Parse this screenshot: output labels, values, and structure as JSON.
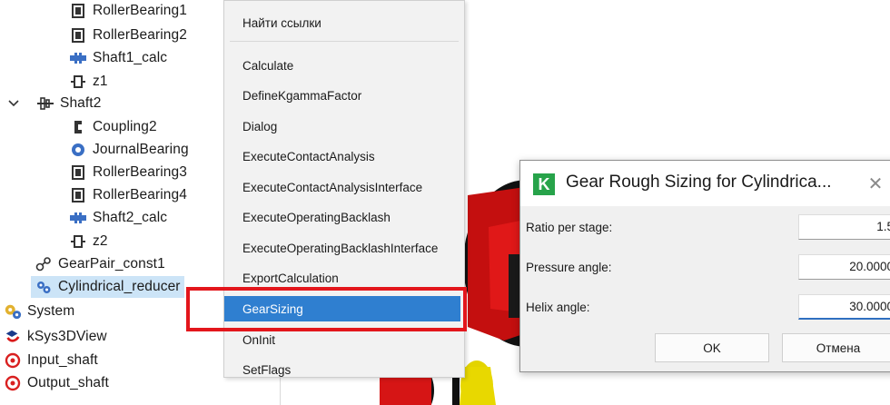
{
  "tree": {
    "items": [
      {
        "label": "RollerBearing1",
        "icon": "bearing-icon"
      },
      {
        "label": "RollerBearing2",
        "icon": "bearing-icon"
      },
      {
        "label": "Shaft1_calc",
        "icon": "shaft-calc-icon"
      },
      {
        "label": "z1",
        "icon": "gear-node-icon"
      },
      {
        "label": "Shaft2",
        "icon": "shaft-icon"
      },
      {
        "label": "Coupling2",
        "icon": "coupling-icon"
      },
      {
        "label": "JournalBearing",
        "icon": "journal-bearing-icon"
      },
      {
        "label": "RollerBearing3",
        "icon": "bearing-icon"
      },
      {
        "label": "RollerBearing4",
        "icon": "bearing-icon"
      },
      {
        "label": "Shaft2_calc",
        "icon": "shaft-calc-icon"
      },
      {
        "label": "z2",
        "icon": "gear-node-icon"
      },
      {
        "label": "GearPair_const1",
        "icon": "gear-pair-icon"
      },
      {
        "label": "Cylindrical_reducer",
        "icon": "cylindrical-reducer-icon"
      },
      {
        "label": "System",
        "icon": "system-icon"
      },
      {
        "label": "kSys3DView",
        "icon": "view3d-icon"
      },
      {
        "label": "Input_shaft",
        "icon": "input-shaft-icon"
      },
      {
        "label": "Output_shaft",
        "icon": "output-shaft-icon"
      }
    ]
  },
  "context_menu": {
    "items": [
      "Найти ссылки",
      "Calculate",
      "DefineKgammaFactor",
      "Dialog",
      "ExecuteContactAnalysis",
      "ExecuteContactAnalysisInterface",
      "ExecuteOperatingBacklash",
      "ExecuteOperatingBacklashInterface",
      "ExportCalculation",
      "GearSizing",
      "OnInit",
      "SetFlags"
    ],
    "highlighted": "GearSizing"
  },
  "dialog": {
    "title": "Gear Rough Sizing for Cylindrica...",
    "logo_letter": "K",
    "close_glyph": "✕",
    "fields": [
      {
        "label": "Ratio per stage:",
        "value": "1.5"
      },
      {
        "label": "Pressure angle:",
        "value": "20.0000"
      },
      {
        "label": "Helix angle:",
        "value": "30.0000"
      }
    ],
    "ok_label": "OK",
    "cancel_label": "Отмена"
  },
  "colors": {
    "selection_bg": "#cce4f7",
    "menu_highlight": "#2f7fd0",
    "annotation_red": "#e3161c",
    "logo_green": "#27a34a",
    "gear_red": "#cc1010",
    "gear_yellow": "#e8d800"
  }
}
